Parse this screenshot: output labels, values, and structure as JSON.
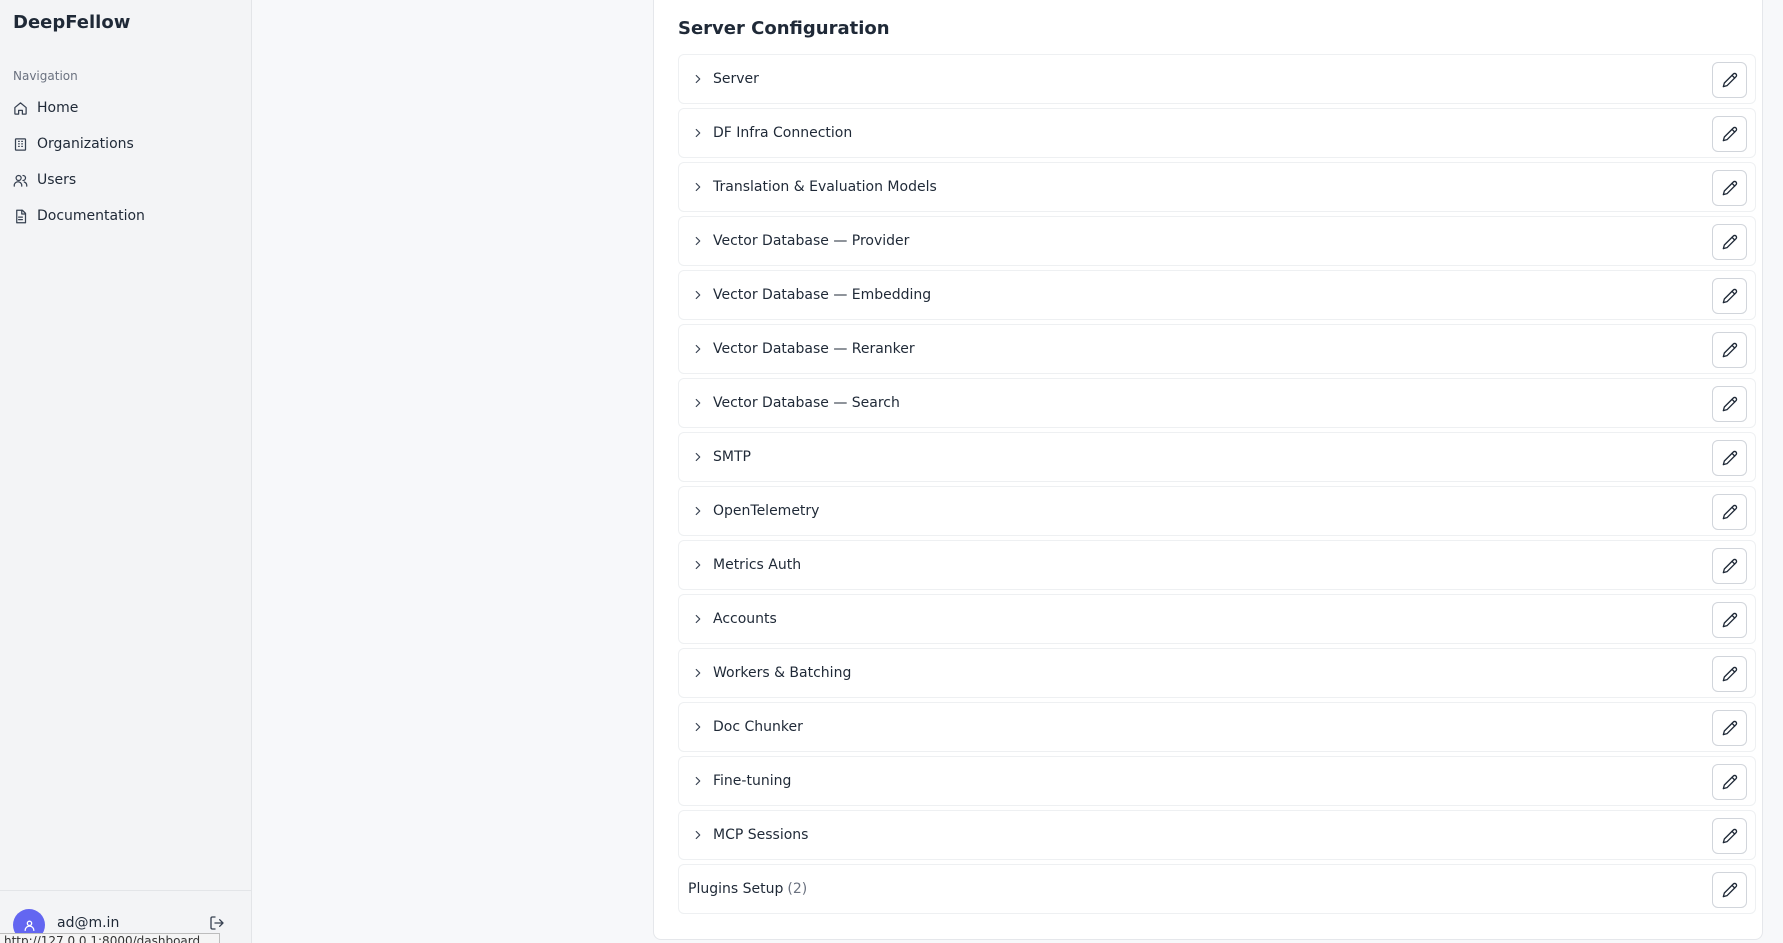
{
  "app": {
    "brand": "DeepFellow"
  },
  "sidebar": {
    "section_label": "Navigation",
    "items": [
      {
        "label": "Home",
        "icon": "home-icon"
      },
      {
        "label": "Organizations",
        "icon": "building-icon"
      },
      {
        "label": "Users",
        "icon": "users-icon"
      },
      {
        "label": "Documentation",
        "icon": "document-icon"
      }
    ],
    "user": {
      "email": "ad@m.in"
    }
  },
  "status_bar": {
    "url": "http://127.0.0.1:8000/dashboard"
  },
  "main": {
    "title": "Server Configuration",
    "sections": [
      {
        "label": "Server"
      },
      {
        "label": "DF Infra Connection"
      },
      {
        "label": "Translation & Evaluation Models"
      },
      {
        "label": "Vector Database — Provider"
      },
      {
        "label": "Vector Database — Embedding"
      },
      {
        "label": "Vector Database — Reranker"
      },
      {
        "label": "Vector Database — Search"
      },
      {
        "label": "SMTP"
      },
      {
        "label": "OpenTelemetry"
      },
      {
        "label": "Metrics Auth"
      },
      {
        "label": "Accounts"
      },
      {
        "label": "Workers & Batching"
      },
      {
        "label": "Doc Chunker"
      },
      {
        "label": "Fine-tuning"
      },
      {
        "label": "MCP Sessions"
      }
    ],
    "plugins": {
      "label": "Plugins Setup",
      "count": "(2)"
    }
  },
  "colors": {
    "avatar": "#6366f1",
    "sidebar_bg": "#f3f4f6",
    "page_bg": "#f7f8fa"
  }
}
